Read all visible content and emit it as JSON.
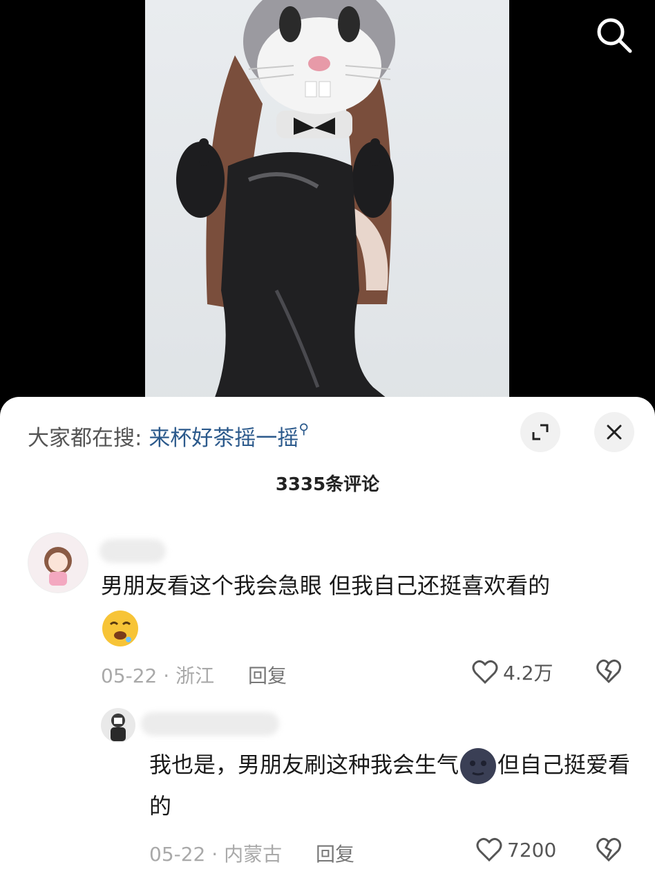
{
  "header": {
    "hot_search_label": "大家都在搜:",
    "hot_search_term": "来杯好茶摇一摇"
  },
  "comments_count": "3335条评论",
  "comments": [
    {
      "text": "男朋友看这个我会急眼 但我自己还挺喜欢看的",
      "date": "05-22",
      "location": "浙江",
      "reply_label": "回复",
      "likes": "4.2万",
      "emoji": "drooling-face-emoji"
    },
    {
      "text_part1": "我也是，男朋友刷这种我会生气",
      "text_part2": "但自己挺爱看的",
      "date": "05-22",
      "location": "内蒙古",
      "reply_label": "回复",
      "likes": "7200",
      "emoji": "dark-moon-face-emoji"
    }
  ],
  "icons": {
    "search": "search-icon",
    "expand": "expand-icon",
    "close": "close-icon",
    "heart": "heart-icon",
    "dislike": "broken-heart-icon"
  },
  "colors": {
    "accent_link": "#2c5a8c",
    "meta_gray": "#a9a9a9"
  }
}
